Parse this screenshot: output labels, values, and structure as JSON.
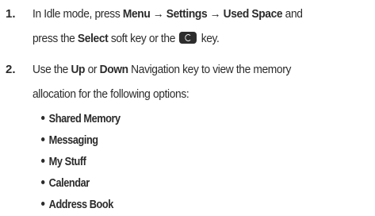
{
  "steps": [
    {
      "number": "1.",
      "text_before_menu": "In Idle mode, press ",
      "menu": "Menu",
      "arrow1": " → ",
      "settings": "Settings",
      "arrow2": " → ",
      "used_space": "Used Space",
      "text_and": " and",
      "text_press": "press the ",
      "select": "Select",
      "text_softkey": " soft key or the ",
      "text_key": " key."
    },
    {
      "number": "2.",
      "text_use": "Use the ",
      "up": "Up",
      "text_or": " or ",
      "down": "Down",
      "text_nav": " Navigation key to view the memory",
      "text_line2": "allocation for the following options:"
    }
  ],
  "options": [
    "Shared Memory",
    "Messaging",
    "My Stuff",
    "Calendar",
    "Address Book"
  ],
  "icons": {
    "select_key": "ok-key-icon"
  }
}
